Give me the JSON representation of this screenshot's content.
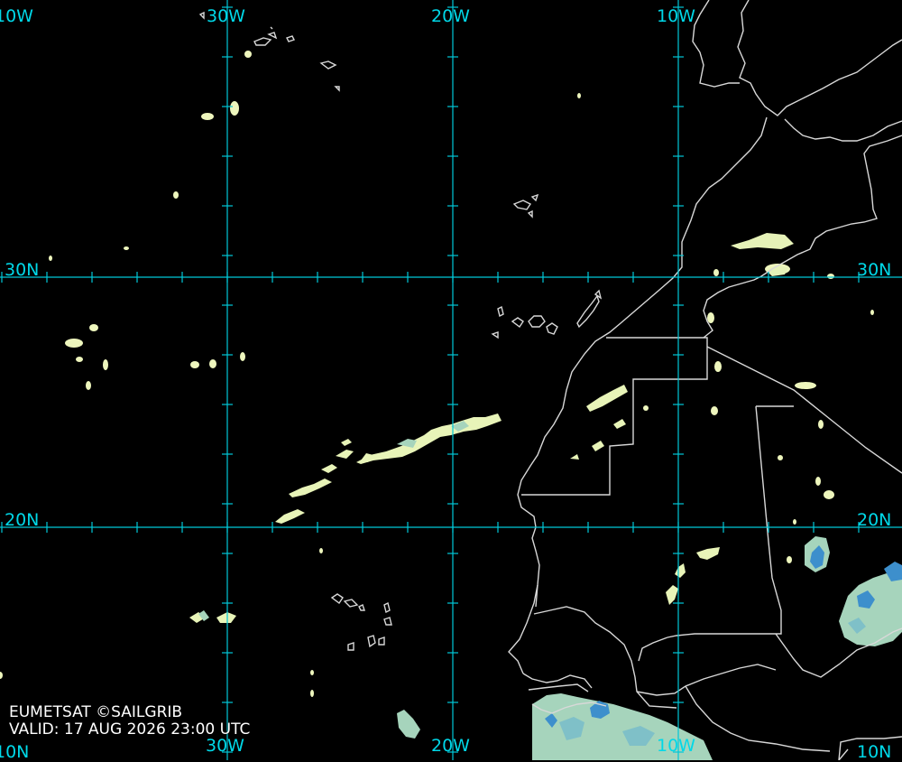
{
  "colors": {
    "background": "#000000",
    "grid": "#00c8d8",
    "label": "#00d8e8",
    "coast": "#d8d8d8",
    "cloud_low": "#f0f7c0",
    "cloud_mid": "#a8d8c0",
    "cloud_high": "#3a8fd0",
    "credit_text": "#ffffff"
  },
  "grid": {
    "longitude_labels": [
      "10W",
      "30W",
      "20W",
      "10W"
    ],
    "latitude_labels_left": [
      "30N",
      "20N",
      "10N"
    ],
    "latitude_labels_right": [
      "30N",
      "20N",
      "10N"
    ],
    "bottom_labels": [
      "30W",
      "20W",
      "10W"
    ]
  },
  "credit": {
    "line1": "EUMETSAT ©SAILGRIB",
    "line2": "VALID:  17 AUG 2026 23:00 UTC"
  }
}
